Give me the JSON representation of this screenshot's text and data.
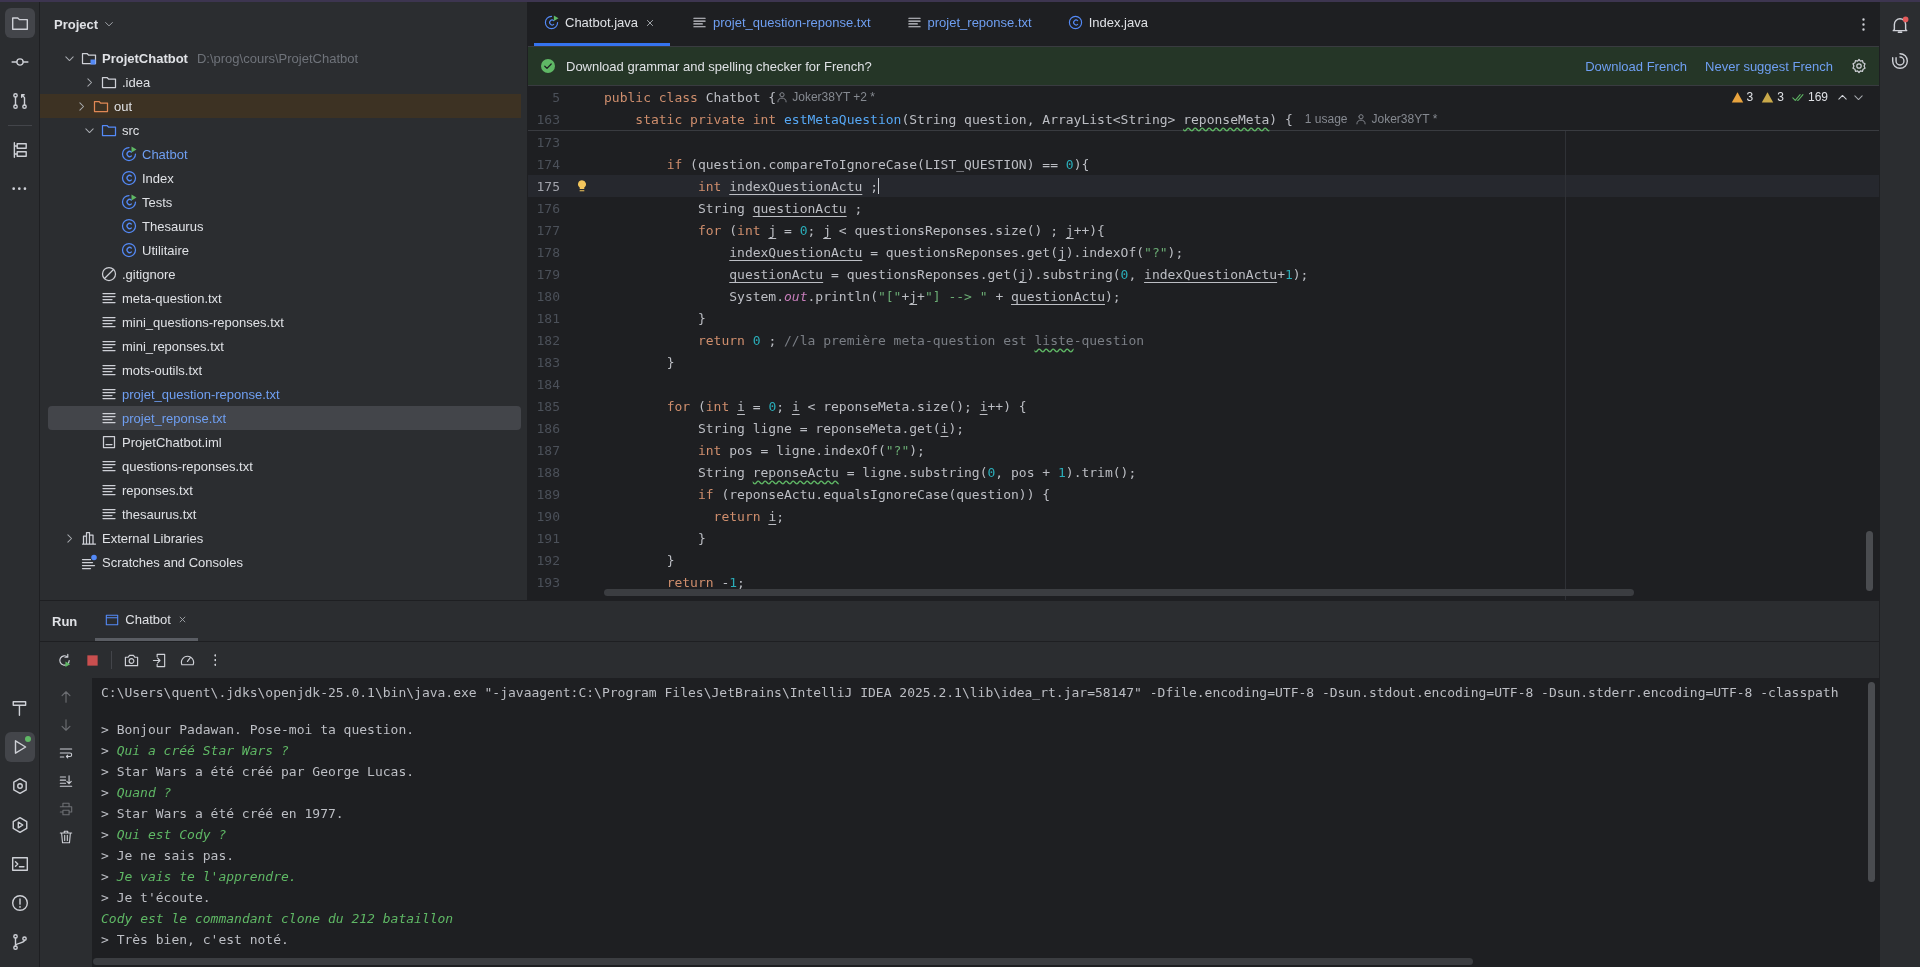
{
  "left_toolbar": {
    "top": [
      {
        "kind": "project",
        "selected": true
      },
      {
        "kind": "commit",
        "selected": false
      },
      {
        "kind": "pull-requests",
        "selected": false
      }
    ],
    "tools": [
      {
        "kind": "structure",
        "selected": false
      },
      {
        "kind": "more",
        "selected": false
      }
    ],
    "bottom": [
      {
        "kind": "build",
        "selected": false,
        "running": false
      },
      {
        "kind": "run",
        "selected": true,
        "running": true
      },
      {
        "kind": "services",
        "selected": false,
        "running": false
      },
      {
        "kind": "debug",
        "selected": false,
        "running": false
      },
      {
        "kind": "terminal",
        "selected": false,
        "running": false
      },
      {
        "kind": "problems",
        "selected": false,
        "running": false
      },
      {
        "kind": "git",
        "selected": false,
        "running": false
      }
    ]
  },
  "project": {
    "title": "Project",
    "tree": [
      {
        "label": "ProjetChatbot",
        "hint": "D:\\prog\\cours\\ProjetChatbot",
        "kind": "project",
        "expanded": true,
        "selected": false,
        "modified": false,
        "children": [
          {
            "label": ".idea",
            "kind": "folder",
            "expanded": false,
            "selected": false,
            "modified": false
          },
          {
            "label": "out",
            "kind": "excluded-folder",
            "expanded": false,
            "selected": false,
            "modified": false
          },
          {
            "label": "src",
            "kind": "source-folder",
            "expanded": true,
            "selected": false,
            "modified": false,
            "children": [
              {
                "label": "Chatbot",
                "kind": "runnable-class",
                "selected": false,
                "modified": true
              },
              {
                "label": "Index",
                "kind": "class",
                "selected": false,
                "modified": false
              },
              {
                "label": "Tests",
                "kind": "runnable-class",
                "selected": false,
                "modified": false
              },
              {
                "label": "Thesaurus",
                "kind": "class",
                "selected": false,
                "modified": false
              },
              {
                "label": "Utilitaire",
                "kind": "class",
                "selected": false,
                "modified": false
              }
            ]
          },
          {
            "label": ".gitignore",
            "kind": "ignore",
            "selected": false,
            "modified": false
          },
          {
            "label": "meta-question.txt",
            "kind": "text",
            "selected": false,
            "modified": false
          },
          {
            "label": "mini_questions-reponses.txt",
            "kind": "text",
            "selected": false,
            "modified": false
          },
          {
            "label": "mini_reponses.txt",
            "kind": "text",
            "selected": false,
            "modified": false
          },
          {
            "label": "mots-outils.txt",
            "kind": "text",
            "selected": false,
            "modified": false
          },
          {
            "label": "projet_question-reponse.txt",
            "kind": "text",
            "selected": false,
            "modified": true
          },
          {
            "label": "projet_reponse.txt",
            "kind": "text",
            "selected": true,
            "modified": true
          },
          {
            "label": "ProjetChatbot.iml",
            "kind": "module",
            "selected": false,
            "modified": false
          },
          {
            "label": "questions-reponses.txt",
            "kind": "text",
            "selected": false,
            "modified": false
          },
          {
            "label": "reponses.txt",
            "kind": "text",
            "selected": false,
            "modified": false
          },
          {
            "label": "thesaurus.txt",
            "kind": "text",
            "selected": false,
            "modified": false
          }
        ]
      },
      {
        "label": "External Libraries",
        "kind": "libraries",
        "expanded": false,
        "selected": false,
        "modified": false
      },
      {
        "label": "Scratches and Consoles",
        "kind": "scratches",
        "selected": false,
        "modified": false
      }
    ]
  },
  "editor": {
    "tabs": [
      {
        "label": "Chatbot.java",
        "kind": "runnable-class",
        "selected": true,
        "modified": false
      },
      {
        "label": "projet_question-reponse.txt",
        "kind": "text",
        "selected": false,
        "modified": true
      },
      {
        "label": "projet_reponse.txt",
        "kind": "text",
        "selected": false,
        "modified": true
      },
      {
        "label": "Index.java",
        "kind": "class",
        "selected": false,
        "modified": false
      }
    ],
    "notification": {
      "text": "Download grammar and spelling checker for French?",
      "actions": [
        "Download French",
        "Never suggest French"
      ]
    },
    "inspections": [
      {
        "kind": "warning",
        "count": "3"
      },
      {
        "kind": "weak-warning",
        "count": "3"
      },
      {
        "kind": "typo",
        "count": "169"
      }
    ],
    "sticky_lines": [
      {
        "number": "5",
        "tokens": [
          {
            "text": "public class",
            "kind": "kw"
          },
          {
            "text": " Chatbot {",
            "kind": "p"
          }
        ],
        "hints": [
          {
            "kind": "author",
            "text": "Joker38YT +2 *"
          }
        ]
      },
      {
        "number": "163",
        "tokens": [
          {
            "text": "    static private int ",
            "kind": "kw"
          },
          {
            "text": "estMetaQuestion",
            "kind": "fn"
          },
          {
            "text": "(String question, ArrayList<String> ",
            "kind": "p"
          },
          {
            "text": "reponseMeta",
            "kind": "typo"
          },
          {
            "text": ") {",
            "kind": "p"
          }
        ],
        "hints": [
          {
            "kind": "usages",
            "text": "1 usage"
          },
          {
            "kind": "author",
            "text": "Joker38YT *"
          }
        ]
      }
    ],
    "lines": [
      {
        "number": "173",
        "current": false
      },
      {
        "number": "174",
        "current": false,
        "tokens": [
          {
            "text": "        if",
            "kind": "kw"
          },
          {
            "text": " (question.compareToIgnoreCase(LIST_QUESTION) == ",
            "kind": "p"
          },
          {
            "text": "0",
            "kind": "num"
          },
          {
            "text": "){",
            "kind": "p"
          }
        ]
      },
      {
        "number": "175",
        "current": true,
        "tokens": [
          {
            "text": "            int ",
            "kind": "kw"
          },
          {
            "text": "indexQuestionActu",
            "kind": "u"
          },
          {
            "text": " ;",
            "kind": "p"
          }
        ]
      },
      {
        "number": "176",
        "current": false,
        "tokens": [
          {
            "text": "            String ",
            "kind": "p"
          },
          {
            "text": "questionActu",
            "kind": "u"
          },
          {
            "text": " ;",
            "kind": "p"
          }
        ]
      },
      {
        "number": "177",
        "current": false,
        "tokens": [
          {
            "text": "            for",
            "kind": "kw"
          },
          {
            "text": " (",
            "kind": "p"
          },
          {
            "text": "int ",
            "kind": "kw"
          },
          {
            "text": "j",
            "kind": "u"
          },
          {
            "text": " = ",
            "kind": "p"
          },
          {
            "text": "0",
            "kind": "num"
          },
          {
            "text": "; ",
            "kind": "p"
          },
          {
            "text": "j",
            "kind": "u"
          },
          {
            "text": " < questionsReponses.size() ; ",
            "kind": "p"
          },
          {
            "text": "j",
            "kind": "u"
          },
          {
            "text": "++){",
            "kind": "p"
          }
        ]
      },
      {
        "number": "178",
        "current": false,
        "tokens": [
          {
            "text": "                indexQuestionActu",
            "kind": "u"
          },
          {
            "text": " = questionsReponses.get(",
            "kind": "p"
          },
          {
            "text": "j",
            "kind": "u"
          },
          {
            "text": ").indexOf(",
            "kind": "p"
          },
          {
            "text": "\"?\"",
            "kind": "str"
          },
          {
            "text": ");",
            "kind": "p"
          }
        ]
      },
      {
        "number": "179",
        "current": false,
        "tokens": [
          {
            "text": "                questionActu",
            "kind": "u"
          },
          {
            "text": " = questionsReponses.get(",
            "kind": "p"
          },
          {
            "text": "j",
            "kind": "u"
          },
          {
            "text": ").substring(",
            "kind": "p"
          },
          {
            "text": "0",
            "kind": "num"
          },
          {
            "text": ", ",
            "kind": "p"
          },
          {
            "text": "indexQuestionActu",
            "kind": "u"
          },
          {
            "text": "+",
            "kind": "p"
          },
          {
            "text": "1",
            "kind": "num"
          },
          {
            "text": ");",
            "kind": "p"
          }
        ]
      },
      {
        "number": "180",
        "current": false,
        "tokens": [
          {
            "text": "                System.",
            "kind": "p"
          },
          {
            "text": "out",
            "kind": "field"
          },
          {
            "text": ".println(",
            "kind": "p"
          },
          {
            "text": "\"[\"",
            "kind": "str"
          },
          {
            "text": "+",
            "kind": "p"
          },
          {
            "text": "j",
            "kind": "u"
          },
          {
            "text": "+",
            "kind": "p"
          },
          {
            "text": "\"] --> \"",
            "kind": "str"
          },
          {
            "text": " + ",
            "kind": "p"
          },
          {
            "text": "questionActu",
            "kind": "u"
          },
          {
            "text": ");",
            "kind": "p"
          }
        ]
      },
      {
        "number": "181",
        "current": false,
        "tokens": [
          {
            "text": "            }",
            "kind": "p"
          }
        ]
      },
      {
        "number": "182",
        "current": false,
        "tokens": [
          {
            "text": "            return ",
            "kind": "kw"
          },
          {
            "text": "0",
            "kind": "num"
          },
          {
            "text": " ; ",
            "kind": "p"
          },
          {
            "text": "//la première meta-question est ",
            "kind": "comment"
          },
          {
            "text": "liste",
            "kind": "comment-typo"
          },
          {
            "text": "-question",
            "kind": "comment"
          }
        ]
      },
      {
        "number": "183",
        "current": false,
        "tokens": [
          {
            "text": "        }",
            "kind": "p"
          }
        ]
      },
      {
        "number": "184",
        "current": false
      },
      {
        "number": "185",
        "current": false,
        "tokens": [
          {
            "text": "        for",
            "kind": "kw"
          },
          {
            "text": " (",
            "kind": "p"
          },
          {
            "text": "int ",
            "kind": "kw"
          },
          {
            "text": "i",
            "kind": "u"
          },
          {
            "text": " = ",
            "kind": "p"
          },
          {
            "text": "0",
            "kind": "num"
          },
          {
            "text": "; ",
            "kind": "p"
          },
          {
            "text": "i",
            "kind": "u"
          },
          {
            "text": " < reponseMeta.size(); ",
            "kind": "p"
          },
          {
            "text": "i",
            "kind": "u"
          },
          {
            "text": "++) {",
            "kind": "p"
          }
        ]
      },
      {
        "number": "186",
        "current": false,
        "tokens": [
          {
            "text": "            String ligne = reponseMeta.get(",
            "kind": "p"
          },
          {
            "text": "i",
            "kind": "u"
          },
          {
            "text": ");",
            "kind": "p"
          }
        ]
      },
      {
        "number": "187",
        "current": false,
        "tokens": [
          {
            "text": "            int",
            "kind": "kw"
          },
          {
            "text": " pos = ligne.indexOf(",
            "kind": "p"
          },
          {
            "text": "\"?\"",
            "kind": "str"
          },
          {
            "text": ");",
            "kind": "p"
          }
        ]
      },
      {
        "number": "188",
        "current": false,
        "tokens": [
          {
            "text": "            String ",
            "kind": "p"
          },
          {
            "text": "reponseActu",
            "kind": "typo"
          },
          {
            "text": " = ligne.substring(",
            "kind": "p"
          },
          {
            "text": "0",
            "kind": "num"
          },
          {
            "text": ", pos + ",
            "kind": "p"
          },
          {
            "text": "1",
            "kind": "num"
          },
          {
            "text": ").trim();",
            "kind": "p"
          }
        ]
      },
      {
        "number": "189",
        "current": false,
        "tokens": [
          {
            "text": "            if",
            "kind": "kw"
          },
          {
            "text": " (reponseActu.equalsIgnoreCase(question)) {",
            "kind": "p"
          }
        ]
      },
      {
        "number": "190",
        "current": false,
        "tokens": [
          {
            "text": "              return ",
            "kind": "kw"
          },
          {
            "text": "i",
            "kind": "u"
          },
          {
            "text": ";",
            "kind": "p"
          }
        ]
      },
      {
        "number": "191",
        "current": false,
        "tokens": [
          {
            "text": "            }",
            "kind": "p"
          }
        ]
      },
      {
        "number": "192",
        "current": false,
        "tokens": [
          {
            "text": "        }",
            "kind": "p"
          }
        ]
      },
      {
        "number": "193",
        "current": false,
        "tokens": [
          {
            "text": "        return",
            "kind": "kw"
          },
          {
            "text": " -",
            "kind": "p"
          },
          {
            "text": "1",
            "kind": "num"
          },
          {
            "text": ";",
            "kind": "p"
          }
        ]
      }
    ]
  },
  "run": {
    "title": "Run",
    "tabs": [
      {
        "label": "Chatbot",
        "selected": true
      }
    ],
    "toolbar": [
      {
        "kind": "rerun"
      },
      {
        "kind": "stop"
      },
      {
        "kind": "screenshot"
      },
      {
        "kind": "exit"
      },
      {
        "kind": "profiler"
      },
      {
        "kind": "more"
      }
    ],
    "side": [
      {
        "kind": "up",
        "disabled": true
      },
      {
        "kind": "down",
        "disabled": true
      },
      {
        "kind": "wrap",
        "disabled": false
      },
      {
        "kind": "scroll-end",
        "disabled": false
      },
      {
        "kind": "print",
        "disabled": true
      },
      {
        "kind": "clear",
        "disabled": false
      }
    ],
    "console": [
      {
        "kind": "command",
        "text": "C:\\Users\\quent\\.jdks\\openjdk-25.0.1\\bin\\java.exe \"-javaagent:C:\\Program Files\\JetBrains\\IntelliJ IDEA 2025.2.1\\lib\\idea_rt.jar=58147\" -Dfile.encoding=UTF-8 -Dsun.stdout.encoding=UTF-8 -Dsun.stderr.encoding=UTF-8 -classpath"
      },
      {
        "kind": "output",
        "prompt": ">",
        "text": "Bonjour Padawan. Pose-moi ta question."
      },
      {
        "kind": "input",
        "prompt": ">",
        "text": "Qui a créé Star Wars ?"
      },
      {
        "kind": "output",
        "prompt": ">",
        "text": "Star Wars a été créé par George Lucas."
      },
      {
        "kind": "input",
        "prompt": ">",
        "text": "Quand ?"
      },
      {
        "kind": "output",
        "prompt": ">",
        "text": "Star Wars a été créé en 1977."
      },
      {
        "kind": "input",
        "prompt": ">",
        "text": "Qui est Cody ?"
      },
      {
        "kind": "output",
        "prompt": ">",
        "text": "Je ne sais pas."
      },
      {
        "kind": "input",
        "prompt": ">",
        "text": "Je vais te l'apprendre."
      },
      {
        "kind": "output",
        "prompt": ">",
        "text": "Je t'écoute."
      },
      {
        "kind": "input",
        "text": "Cody est le commandant clone du 212 bataillon"
      },
      {
        "kind": "output",
        "prompt": ">",
        "text": "Très bien, c'est noté."
      }
    ]
  }
}
